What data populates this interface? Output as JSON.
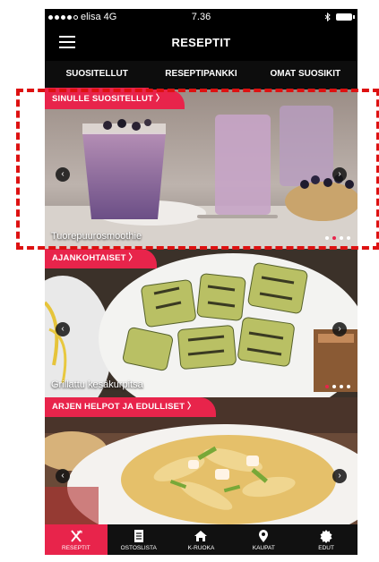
{
  "status": {
    "carrier": "elisa",
    "network": "4G",
    "time": "7.36"
  },
  "header": {
    "title": "RESEPTIT"
  },
  "tabs": [
    {
      "label": "SUOSITELLUT"
    },
    {
      "label": "RESEPTIPANKKI"
    },
    {
      "label": "OMAT SUOSIKIT"
    }
  ],
  "sections": [
    {
      "banner": "SINULLE SUOSITELLUT 〉",
      "caption": "Tuorepuurosmoothie"
    },
    {
      "banner": "AJANKOHTAISET 〉",
      "caption": "Grillattu kesäkurpitsa"
    },
    {
      "banner": "ARJEN HELPOT JA EDULLISET 〉",
      "caption": ""
    }
  ],
  "carousel": {
    "prev_symbol": "‹",
    "next_symbol": "›"
  },
  "bottom_nav": [
    {
      "label": "RESEPTIT",
      "icon": "fork-knife-icon"
    },
    {
      "label": "OSTOSLISTA",
      "icon": "list-icon"
    },
    {
      "label": "K-RUOKA",
      "icon": "home-icon"
    },
    {
      "label": "KAUPAT",
      "icon": "map-pin-icon"
    },
    {
      "label": "EDUT",
      "icon": "badge-icon"
    }
  ],
  "colors": {
    "accent": "#e8244b",
    "bar": "#000000",
    "highlight": "#dd1111"
  }
}
